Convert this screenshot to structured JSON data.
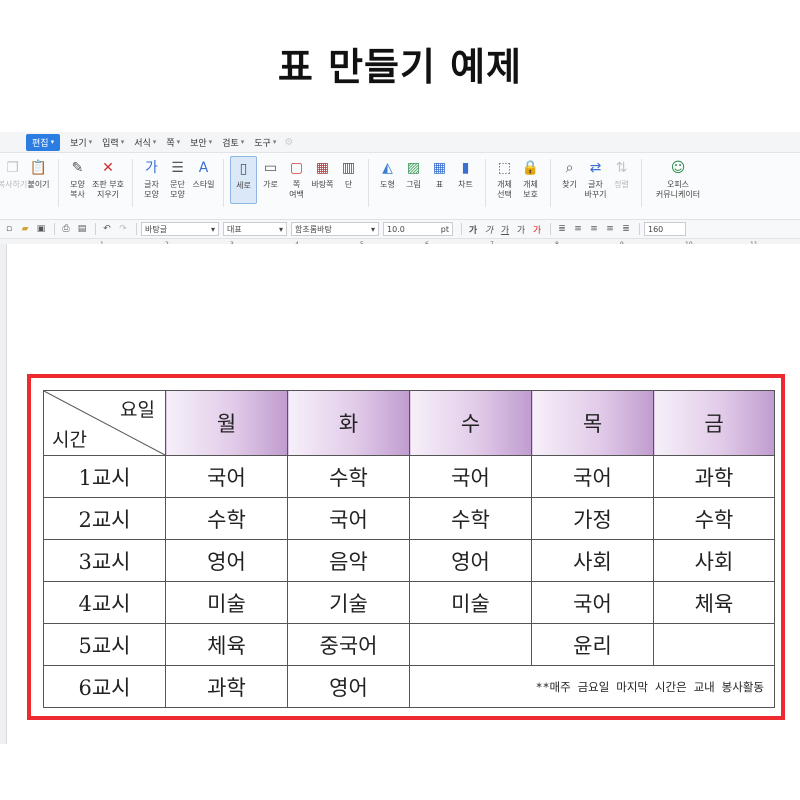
{
  "page_title": "표 만들기 예제",
  "menubar": {
    "items": [
      "편집",
      "보기",
      "입력",
      "서식",
      "쪽",
      "보안",
      "검토",
      "도구"
    ],
    "active_index": 0
  },
  "ribbon": {
    "buttons": [
      {
        "label1": "복사하기",
        "label2": "",
        "icon": "copy-icon",
        "disabled": true
      },
      {
        "label1": "붙이기",
        "label2": "",
        "icon": "paste-icon"
      },
      {
        "label1": "모양",
        "label2": "복사",
        "icon": "format-copy-icon"
      },
      {
        "label1": "조판 부호",
        "label2": "지우기",
        "icon": "clear-codes-icon"
      },
      {
        "label1": "글자",
        "label2": "모양",
        "icon": "char-shape-icon"
      },
      {
        "label1": "문단",
        "label2": "모양",
        "icon": "para-shape-icon"
      },
      {
        "label1": "스타일",
        "label2": "",
        "icon": "style-icon"
      },
      {
        "label1": "세로",
        "label2": "",
        "icon": "portrait-icon",
        "selected": true
      },
      {
        "label1": "가로",
        "label2": "",
        "icon": "landscape-icon"
      },
      {
        "label1": "쪽",
        "label2": "여백",
        "icon": "margin-icon"
      },
      {
        "label1": "바탕쪽",
        "label2": "",
        "icon": "master-page-icon"
      },
      {
        "label1": "단",
        "label2": "",
        "icon": "columns-icon"
      },
      {
        "label1": "도형",
        "label2": "",
        "icon": "shape-icon"
      },
      {
        "label1": "그림",
        "label2": "",
        "icon": "picture-icon"
      },
      {
        "label1": "표",
        "label2": "",
        "icon": "table-icon"
      },
      {
        "label1": "차트",
        "label2": "",
        "icon": "chart-icon"
      },
      {
        "label1": "개체",
        "label2": "선택",
        "icon": "object-select-icon"
      },
      {
        "label1": "개체",
        "label2": "보호",
        "icon": "object-protect-icon"
      },
      {
        "label1": "찾기",
        "label2": "",
        "icon": "find-icon"
      },
      {
        "label1": "글자",
        "label2": "바꾸기",
        "icon": "replace-icon"
      },
      {
        "label1": "정렬",
        "label2": "",
        "icon": "sort-icon",
        "disabled": true
      },
      {
        "label1": "오피스",
        "label2": "커뮤니케이터",
        "icon": "communicator-icon"
      }
    ]
  },
  "toolbar2": {
    "style_value": "바탕글",
    "para_value": "대표",
    "font_value": "함초롬바탕",
    "size_value": "10.0",
    "size_unit": "pt",
    "zoom_value": "160",
    "format_glyphs": [
      "가",
      "가",
      "가",
      "가",
      "가"
    ]
  },
  "ruler": {
    "numbers": [
      "1",
      "2",
      "3",
      "4",
      "5",
      "6",
      "7",
      "8",
      "9",
      "10",
      "11"
    ]
  },
  "timetable": {
    "corner_top": "요일",
    "corner_bottom": "시간",
    "days": [
      "월",
      "화",
      "수",
      "목",
      "금"
    ],
    "rows": [
      {
        "period": "1교시",
        "cells": [
          "국어",
          "수학",
          "국어",
          "국어",
          "과학"
        ]
      },
      {
        "period": "2교시",
        "cells": [
          "수학",
          "국어",
          "수학",
          "가정",
          "수학"
        ]
      },
      {
        "period": "3교시",
        "cells": [
          "영어",
          "음악",
          "영어",
          "사회",
          "사회"
        ]
      },
      {
        "period": "4교시",
        "cells": [
          "미술",
          "기술",
          "미술",
          "국어",
          "체육"
        ]
      },
      {
        "period": "5교시",
        "cells": [
          "체육",
          "중국어",
          "",
          "윤리",
          ""
        ]
      },
      {
        "period": "6교시",
        "cells": [
          "과학",
          "영어"
        ]
      }
    ],
    "note": "**매주 금요일 마지막 시간은 교내 봉사활동"
  },
  "colors": {
    "highlight": "#ec2a2f",
    "header_gradient_end": "#c09ccf",
    "active_menu": "#2b7de1"
  }
}
